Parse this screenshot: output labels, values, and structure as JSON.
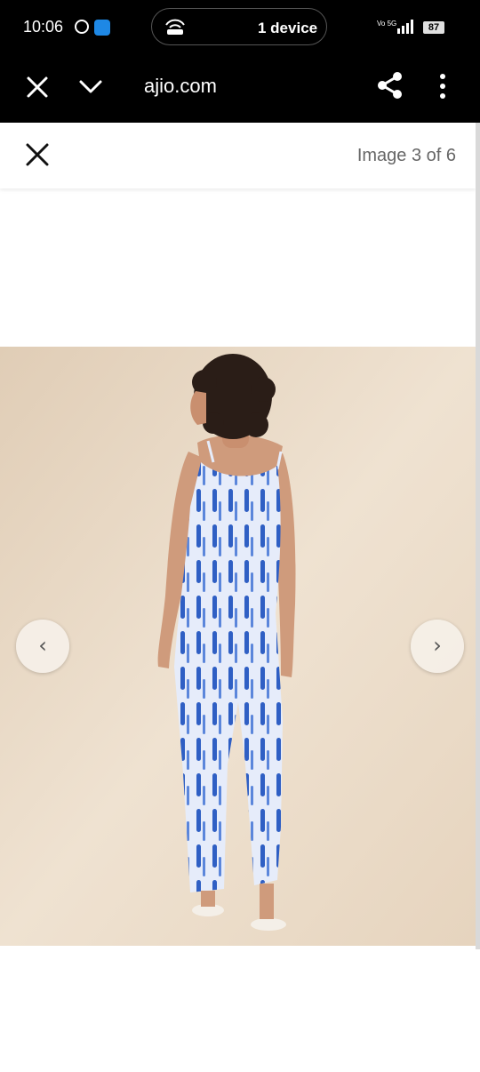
{
  "status_bar": {
    "time": "10:06",
    "cast_label": "1 device",
    "network": "Vo 5G",
    "battery": "87"
  },
  "browser": {
    "url": "ajio.com"
  },
  "viewer": {
    "counter": "Image 3 of 6",
    "prev_icon": "chevron-left",
    "next_icon": "chevron-right"
  },
  "photo": {
    "subject": "model in blue tie-dye jumpsuit, back view",
    "colors": {
      "background": "#eadbc8",
      "fabric_base": "#e6ecfa",
      "fabric_stripe": "#2f5fc4",
      "hair": "#2a1d17",
      "skin": "#cf9b7c"
    }
  }
}
